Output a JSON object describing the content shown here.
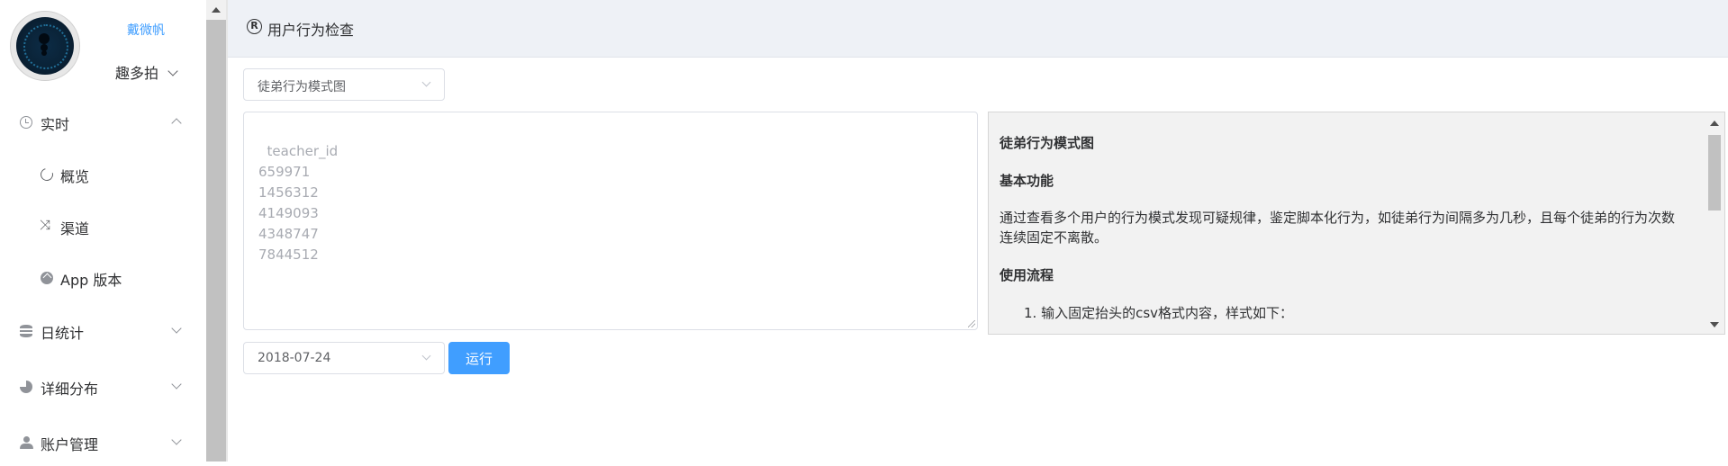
{
  "sidebar": {
    "user_name": "戴微帆",
    "app_name": "趣多拍",
    "items": [
      {
        "label": "实时",
        "icon": "clock-icon",
        "expanded": true
      },
      {
        "label": "概览",
        "icon": "refresh-icon"
      },
      {
        "label": "渠道",
        "icon": "shuffle-icon"
      },
      {
        "label": "App 版本",
        "icon": "app-badge-icon"
      },
      {
        "label": "日统计",
        "icon": "database-icon",
        "expanded": false
      },
      {
        "label": "详细分布",
        "icon": "pie-chart-icon",
        "expanded": false
      },
      {
        "label": "账户管理",
        "icon": "users-icon",
        "expanded": false
      }
    ]
  },
  "header": {
    "icon": "registered-icon",
    "title": "用户行为检查"
  },
  "main": {
    "mode_select": {
      "value": "徒弟行为模式图"
    },
    "input": {
      "text": "teacher_id\n659971\n1456312\n4149093\n4348747\n7844512"
    },
    "date_select": {
      "value": "2018-07-24"
    },
    "run_label": "运行"
  },
  "help": {
    "title": "徒弟行为模式图",
    "section_basic": "基本功能",
    "basic_text": "通过查看多个用户的行为模式发现可疑规律，鉴定脚本化行为，如徒弟行为间隔多为几秒，且每个徒弟的行为次数连续固定不离散。",
    "section_usage": "使用流程",
    "step_1": "1. 输入固定抬头的csv格式内容，样式如下："
  },
  "colors": {
    "accent": "#409eff",
    "header_bg": "#eef1f6",
    "panel_bg": "#f2f2f2"
  }
}
